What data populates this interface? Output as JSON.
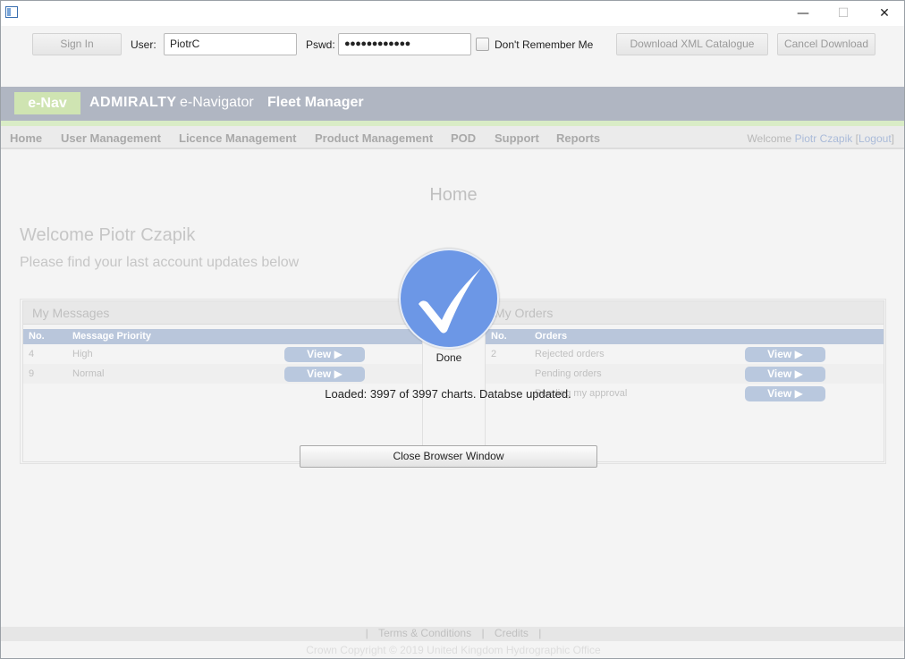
{
  "window": {
    "minimize": "—",
    "maximize": "☐",
    "close": "✕"
  },
  "toolbar": {
    "sign_in": "Sign In",
    "user_label": "User:",
    "user_value": "PiotrC",
    "pswd_label": "Pswd:",
    "pswd_value": "●●●●●●●●●●●●",
    "dont_remember": "Don't Remember Me",
    "download_xml": "Download XML Catalogue",
    "cancel_download": "Cancel Download"
  },
  "brand": {
    "badge": "e-Nav",
    "admiralty": "ADMIRALTY",
    "navigator": "e-Navigator",
    "product": "Fleet Manager"
  },
  "nav": {
    "items": [
      "Home",
      "User Management",
      "Licence Management",
      "Product Management",
      "POD",
      "Support",
      "Reports"
    ],
    "welcome_prefix": "Welcome",
    "welcome_name": "Piotr Czapik",
    "logout_open": "[",
    "logout": "Logout",
    "logout_close": "]"
  },
  "page": {
    "title": "Home",
    "welcome": "Welcome Piotr Czapik",
    "subtitle": "Please find your last account updates below"
  },
  "messages": {
    "title": "My Messages",
    "col_no": "No.",
    "col_priority": "Message Priority",
    "rows": [
      {
        "no": "4",
        "priority": "High",
        "action": "View ▶"
      },
      {
        "no": "9",
        "priority": "Normal",
        "action": "View ▶"
      }
    ]
  },
  "orders": {
    "title": "My Orders",
    "col_no": "No.",
    "col_orders": "Orders",
    "rows": [
      {
        "no": "2",
        "label": "Rejected orders",
        "action": "View ▶"
      },
      {
        "no": "",
        "label": "Pending orders",
        "action": "View ▶"
      },
      {
        "no": "",
        "label": "Pending my approval",
        "action": "View ▶"
      }
    ]
  },
  "dialog": {
    "status": "Done",
    "message": "Loaded:  3997 of 3997 charts. Databse updated.",
    "close_button": "Close Browser Window",
    "accent": "#6c97e6"
  },
  "footer": {
    "sep": "|",
    "terms": "Terms & Conditions",
    "credits": "Credits",
    "copyright": "Crown Copyright © 2019 United Kingdom Hydrographic Office"
  }
}
